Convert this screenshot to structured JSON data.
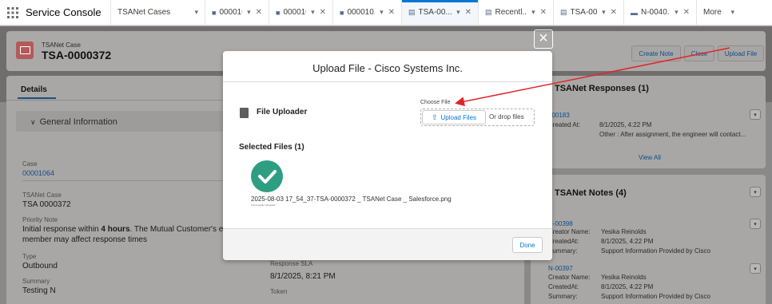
{
  "app": {
    "name": "Service Console"
  },
  "tabs": [
    {
      "label": "TSANet Cases",
      "has_close": false,
      "active": false,
      "icon": ""
    },
    {
      "label": "000010...",
      "has_close": true,
      "active": false,
      "icon": "briefcase-icon"
    },
    {
      "label": "000010...",
      "has_close": true,
      "active": false,
      "icon": "briefcase-icon"
    },
    {
      "label": "000010...",
      "has_close": true,
      "active": false,
      "icon": "briefcase-icon"
    },
    {
      "label": "TSA-00...",
      "has_close": true,
      "active": true,
      "icon": "record-icon"
    },
    {
      "label": "Recentl...",
      "has_close": true,
      "active": false,
      "icon": "record-icon"
    },
    {
      "label": "TSA-00...",
      "has_close": true,
      "active": false,
      "icon": "record-icon"
    },
    {
      "label": "N-0040...",
      "has_close": true,
      "active": false,
      "icon": "note-icon"
    }
  ],
  "more_label": "More",
  "record": {
    "type": "TSANet Case",
    "name": "TSA-0000372",
    "buttons": [
      "Create Note",
      "Close",
      "Upload File"
    ]
  },
  "details": {
    "tab": "Details",
    "section": "General Information",
    "fields": {
      "case_label": "Case",
      "case_value": "00001064",
      "tsanet_case_label": "TSANet Case",
      "tsanet_case_value": "TSA 0000372",
      "priority_label": "Priority Note",
      "priority_pre": "Initial response within ",
      "priority_bold": "4 hours",
      "priority_post": ". The Mutual Customer's entitlen",
      "priority_line2": "member may affect response times",
      "type_label": "Type",
      "type_value": "Outbound",
      "summary_label": "Summary",
      "summary_value": "Testing N",
      "response_label": "Response SLA",
      "response_value": "8/1/2025, 8:21 PM",
      "token_label": "Token"
    }
  },
  "responses": {
    "title": "TSANet Responses (1)",
    "item_id": "000183",
    "created_label": "Created At:",
    "created_value": "8/1/2025, 4:22 PM",
    "note": "Other : After assignment, the engineer will contact...",
    "view_all": "View All"
  },
  "notes": {
    "title": "TSANet Notes (4)",
    "items": [
      {
        "id": "N-00398",
        "creator_label": "Creator Name:",
        "creator": "Yesika Reinolds",
        "created_label": "CreatedAt:",
        "created": "8/1/2025, 4:22 PM",
        "summary_label": "Summary:",
        "summary": "Support Information Provided by Cisco"
      },
      {
        "id": "N-00397",
        "creator_label": "Creator Name:",
        "creator": "Yesika Reinolds",
        "created_label": "CreatedAt:",
        "created": "8/1/2025, 4:22 PM",
        "summary_label": "Summary:",
        "summary": "Support Information Provided by Cisco"
      }
    ]
  },
  "modal": {
    "title": "Upload File - Cisco Systems Inc.",
    "uploader_title": "File Uploader",
    "choose_label": "Choose File",
    "upload_button": "Upload Files",
    "drop_text": "Or drop files",
    "selected_title": "Selected Files (1)",
    "file_name": "2025-08-03 17_54_37-TSA-0000372 _ TSANet Case _ Salesforce.png",
    "file_status": "Successfully Uploaded",
    "done_button": "Done",
    "close_glyph": "×"
  },
  "colors": {
    "accent": "#0176d3",
    "success": "#2e9e83",
    "arrow": "#e0262b"
  }
}
